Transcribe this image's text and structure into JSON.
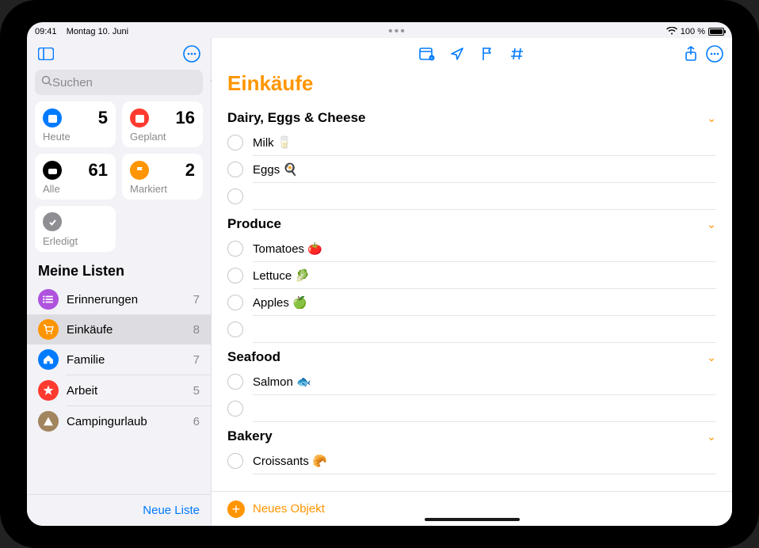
{
  "statusbar": {
    "time": "09:41",
    "date": "Montag 10. Juni",
    "battery": "100 %"
  },
  "sidebar": {
    "search_placeholder": "Suchen",
    "smart": [
      {
        "label": "Heute",
        "count": 5,
        "color": "#007aff",
        "glyph": "calendar"
      },
      {
        "label": "Geplant",
        "count": 16,
        "color": "#ff3b30",
        "glyph": "calendar"
      },
      {
        "label": "Alle",
        "count": 61,
        "color": "#000000",
        "glyph": "tray"
      },
      {
        "label": "Markiert",
        "count": 2,
        "color": "#ff9500",
        "glyph": "flag"
      },
      {
        "label": "Erledigt",
        "count": "",
        "color": "#8e8e93",
        "glyph": "check"
      }
    ],
    "lists_header": "Meine Listen",
    "lists": [
      {
        "name": "Erinnerungen",
        "count": 7,
        "color": "#af52de",
        "glyph": "list"
      },
      {
        "name": "Einkäufe",
        "count": 8,
        "color": "#ff9500",
        "glyph": "cart",
        "selected": true
      },
      {
        "name": "Familie",
        "count": 7,
        "color": "#007aff",
        "glyph": "house"
      },
      {
        "name": "Arbeit",
        "count": 5,
        "color": "#ff3b30",
        "glyph": "star"
      },
      {
        "name": "Campingurlaub",
        "count": 6,
        "color": "#a2845e",
        "glyph": "tent"
      }
    ],
    "new_list_label": "Neue Liste"
  },
  "main": {
    "title": "Einkäufe",
    "new_item_label": "Neues Objekt",
    "sections": [
      {
        "title": "Dairy, Eggs & Cheese",
        "items": [
          "Milk 🥛",
          "Eggs 🍳",
          ""
        ]
      },
      {
        "title": "Produce",
        "items": [
          "Tomatoes 🍅",
          "Lettuce 🥬",
          "Apples 🍏",
          ""
        ]
      },
      {
        "title": "Seafood",
        "items": [
          "Salmon 🐟",
          ""
        ]
      },
      {
        "title": "Bakery",
        "items": [
          "Croissants 🥐"
        ]
      }
    ]
  }
}
